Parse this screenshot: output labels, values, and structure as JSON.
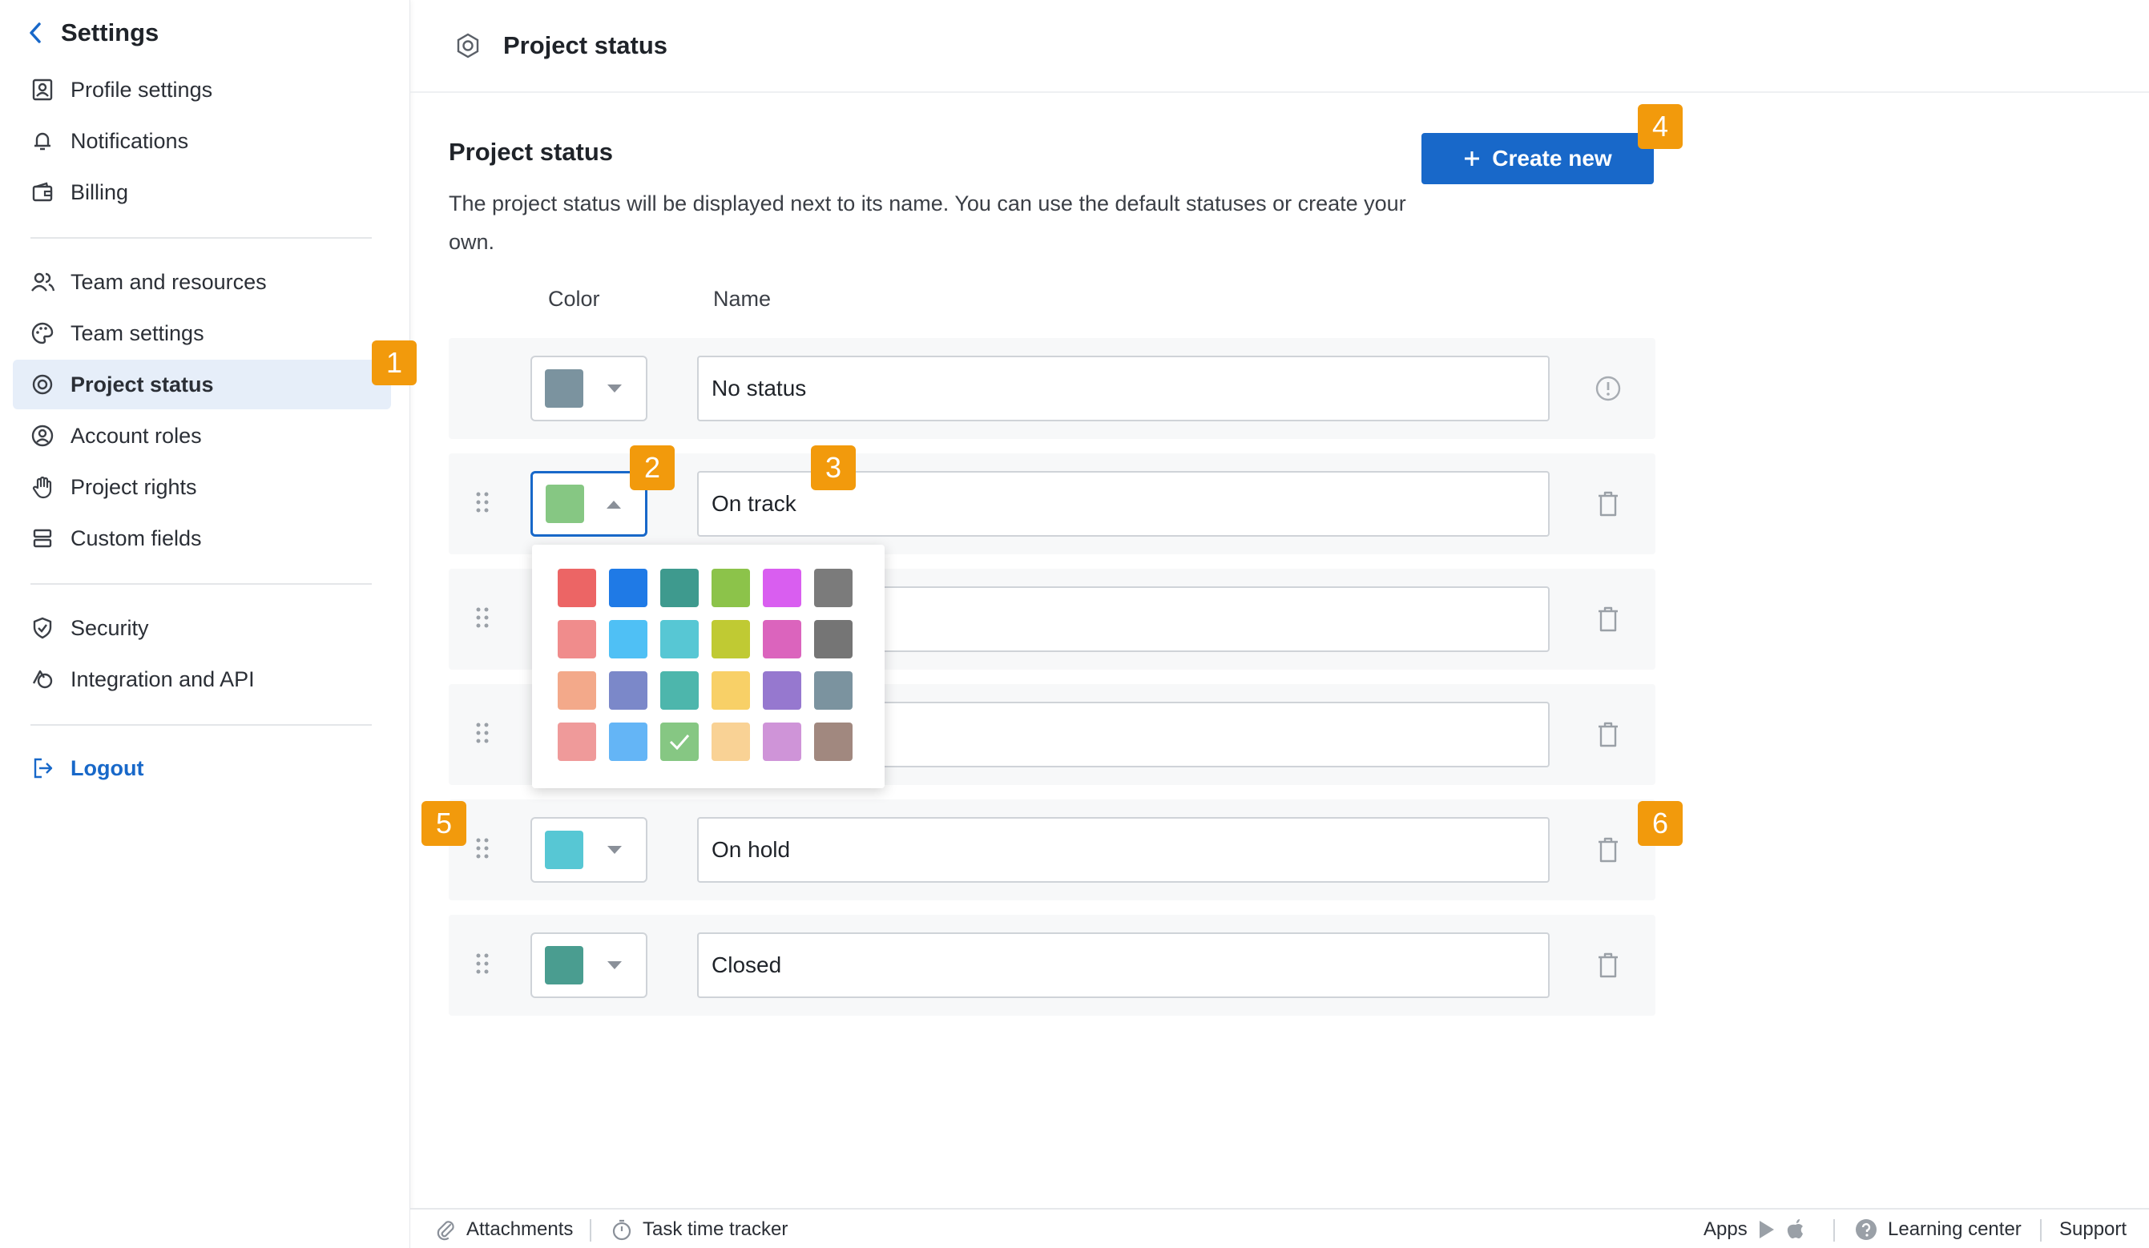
{
  "sidebar": {
    "title": "Settings",
    "items": [
      {
        "label": "Profile settings",
        "icon": "profile-icon"
      },
      {
        "label": "Notifications",
        "icon": "bell-icon"
      },
      {
        "label": "Billing",
        "icon": "wallet-icon"
      },
      {
        "label": "Team and resources",
        "icon": "team-icon"
      },
      {
        "label": "Team settings",
        "icon": "palette-icon"
      },
      {
        "label": "Project status",
        "icon": "status-icon"
      },
      {
        "label": "Account roles",
        "icon": "account-roles-icon"
      },
      {
        "label": "Project rights",
        "icon": "hand-icon"
      },
      {
        "label": "Custom fields",
        "icon": "custom-fields-icon"
      },
      {
        "label": "Security",
        "icon": "shield-icon"
      },
      {
        "label": "Integration and API",
        "icon": "integration-icon"
      }
    ],
    "logout": "Logout",
    "active_item": "Project status"
  },
  "header": {
    "title": "Project status"
  },
  "main": {
    "title": "Project status",
    "description": "The project status will be displayed next to its name. You can use the default statuses or create your own.",
    "create_button": "Create new",
    "columns": {
      "color": "Color",
      "name": "Name"
    },
    "rows": [
      {
        "name": "No status",
        "color": "#7b939f",
        "action": "info-icon"
      },
      {
        "name": "On track",
        "color": "#86c783",
        "action": "trash-icon"
      },
      {
        "name": "",
        "color": "",
        "action": "trash-icon"
      },
      {
        "name": "",
        "color": "",
        "action": "trash-icon"
      },
      {
        "name": "On hold",
        "color": "#57c7d4",
        "action": "trash-icon"
      },
      {
        "name": "Closed",
        "color": "#4a9d90",
        "action": "trash-icon"
      }
    ]
  },
  "palette": {
    "colors": [
      [
        "#ec6565",
        "#1f7ae6",
        "#3e9a8e",
        "#8cc34a",
        "#d95ef0",
        "#7b7b7b"
      ],
      [
        "#f08c8c",
        "#4fc0f5",
        "#57c7d4",
        "#c0ca33",
        "#db64bd",
        "#757575"
      ],
      [
        "#f3a98a",
        "#7b88c9",
        "#4db6ac",
        "#f8d067",
        "#9678cf",
        "#7b939f"
      ],
      [
        "#ef9a9a",
        "#64b5f6",
        "#86c783",
        "#f9d295",
        "#cf94d8",
        "#a1887f"
      ]
    ],
    "selected": "#86c783"
  },
  "markers": [
    "1",
    "2",
    "3",
    "4",
    "5",
    "6"
  ],
  "footer": {
    "attachments": "Attachments",
    "time_tracker": "Task time tracker",
    "apps": "Apps",
    "learning": "Learning center",
    "support": "Support"
  }
}
